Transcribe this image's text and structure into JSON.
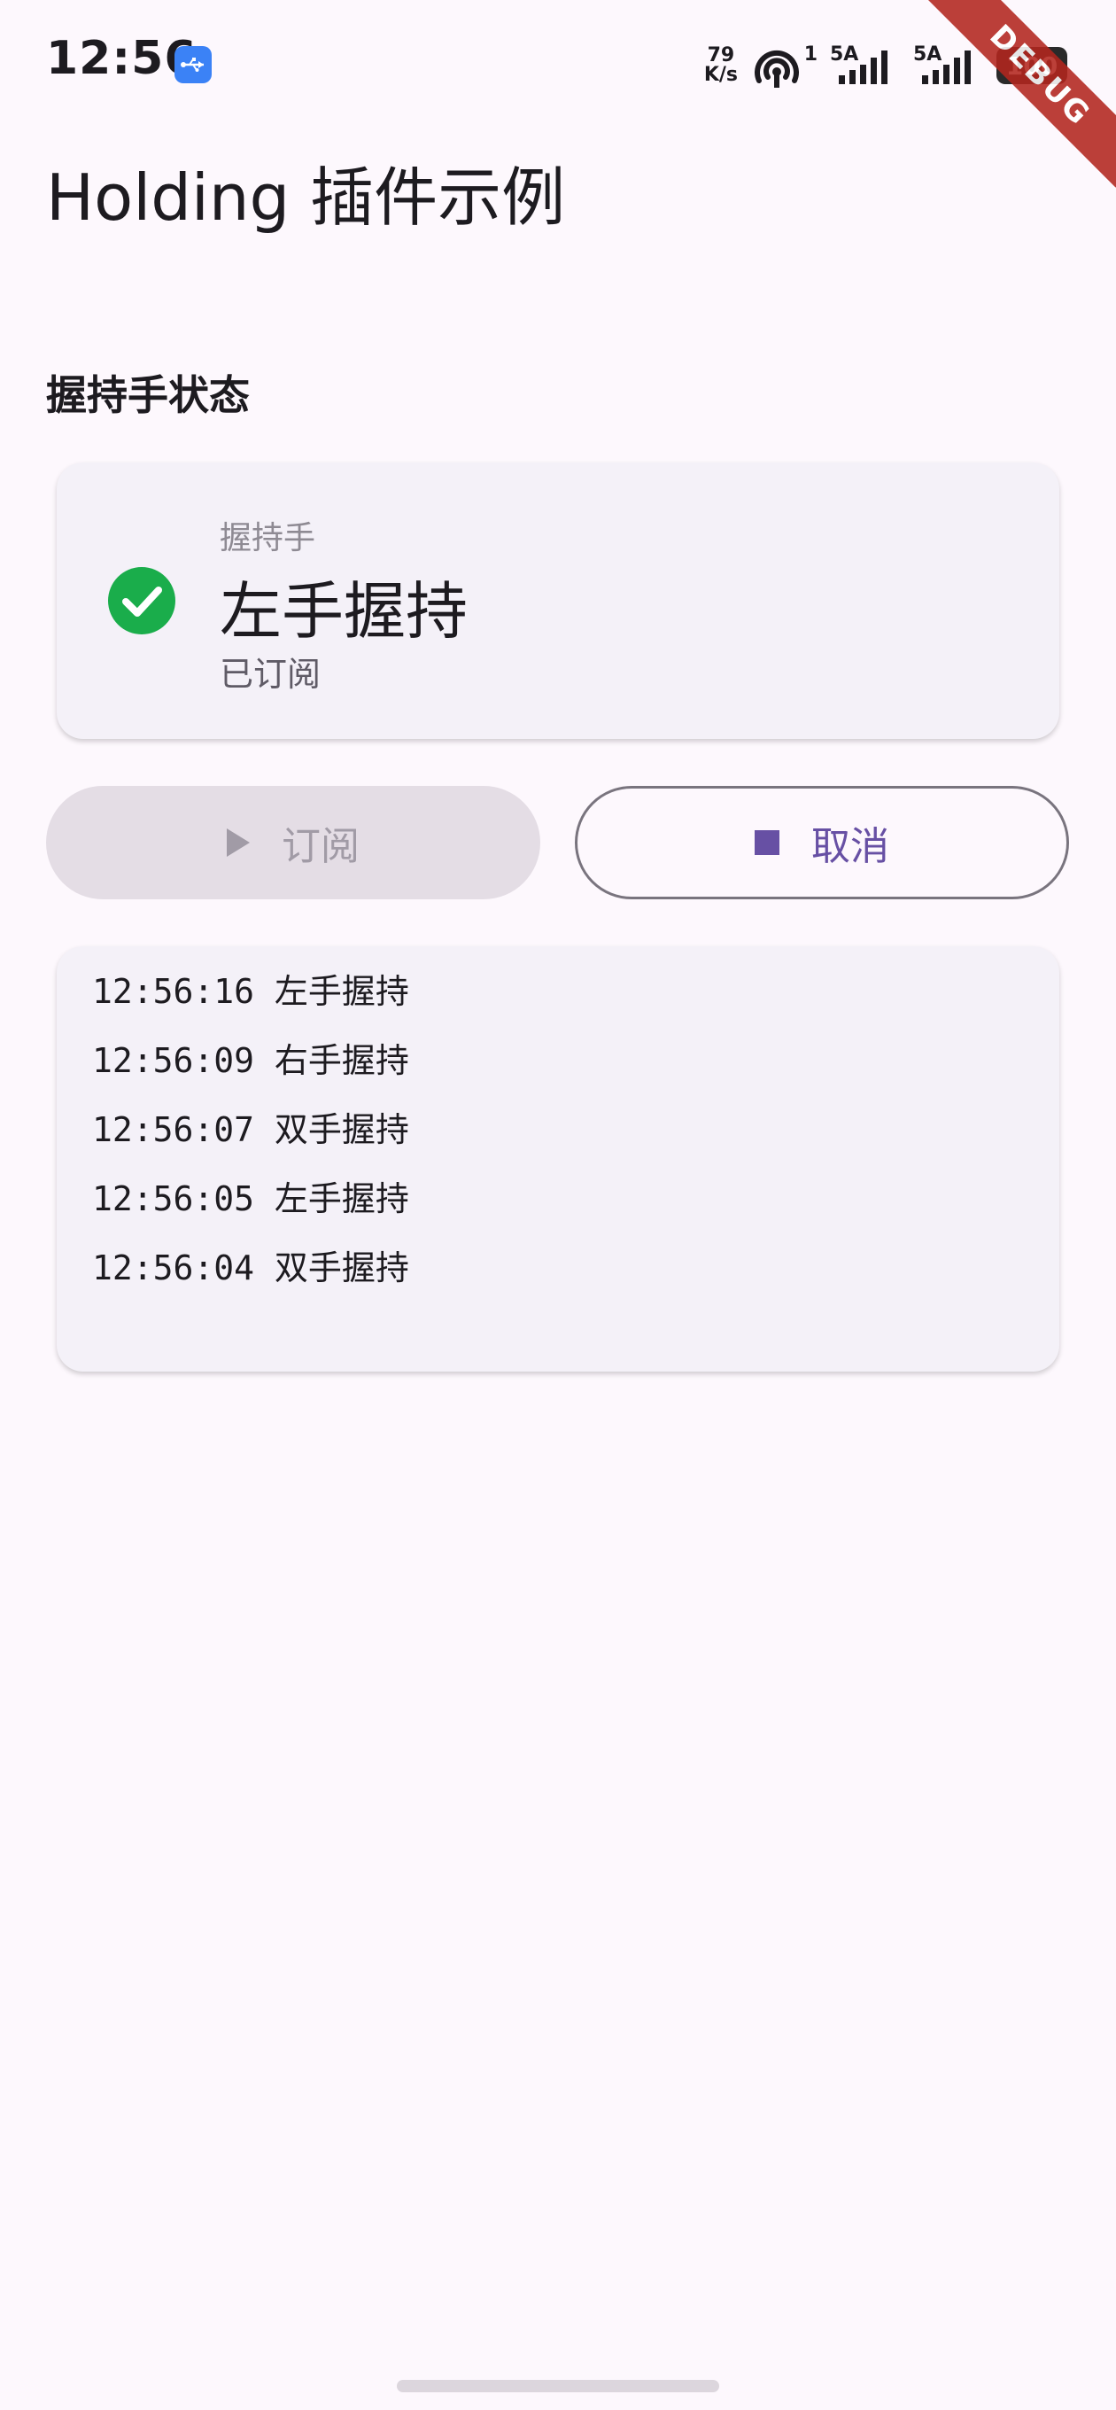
{
  "status_bar": {
    "time": "12:56",
    "net_speed": "79",
    "net_unit": "K/s",
    "hotspot_count": "1",
    "sim1_label": "5A",
    "sim2_label": "5A",
    "battery": "100"
  },
  "debug_banner": "DEBUG",
  "app_bar": {
    "title": "Holding 插件示例"
  },
  "section": {
    "title": "握持手状态"
  },
  "status_card": {
    "label": "握持手",
    "value": "左手握持",
    "status": "已订阅",
    "status_color": "#1aad4b"
  },
  "buttons": {
    "subscribe_label": "订阅",
    "cancel_label": "取消"
  },
  "log": {
    "entries": [
      {
        "time": "12:56:16",
        "text": "左手握持"
      },
      {
        "time": "12:56:09",
        "text": "右手握持"
      },
      {
        "time": "12:56:07",
        "text": "双手握持"
      },
      {
        "time": "12:56:05",
        "text": "左手握持"
      },
      {
        "time": "12:56:04",
        "text": "双手握持"
      }
    ]
  },
  "colors": {
    "background": "#fdf8fd",
    "primary": "#6750a4",
    "success": "#1aad4b",
    "card": "#f4f1f8"
  }
}
